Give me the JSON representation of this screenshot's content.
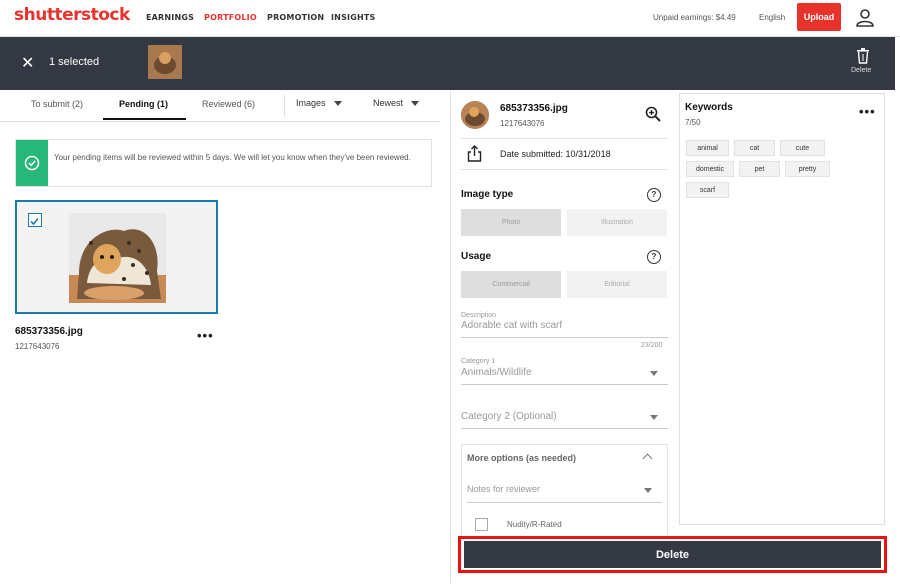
{
  "brand": {
    "logo_text": "shutterstock",
    "accent": "#e8332d"
  },
  "topnav": {
    "items": [
      {
        "label": "EARNINGS",
        "active": false
      },
      {
        "label": "PORTFOLIO",
        "active": true
      },
      {
        "label": "PROMOTION",
        "active": false
      },
      {
        "label": "INSIGHTS",
        "active": false
      }
    ],
    "earnings": "Unpaid earnings: $4.49",
    "language": "English",
    "upload_label": "Upload",
    "user_icon": "user-icon"
  },
  "selection_bar": {
    "close_icon": "close-icon",
    "selected_text": "1 selected",
    "delete_label": "Delete",
    "bg": "#333842"
  },
  "tabs": [
    {
      "label": "To submit (2)",
      "active": false
    },
    {
      "label": "Pending (1)",
      "active": true
    },
    {
      "label": "Reviewed (6)",
      "active": false
    }
  ],
  "filters": {
    "type": "Images",
    "sort": "Newest"
  },
  "notice": {
    "text": "Your pending items will be reviewed within 5 days. We will let you know when they've been reviewed.",
    "color": "#27b77a"
  },
  "item": {
    "filename": "685373356.jpg",
    "id": "1217643076",
    "checked": true
  },
  "details": {
    "filename": "685373356.jpg",
    "id": "1217643076",
    "date_submitted": "Date submitted: 10/31/2018",
    "image_type": {
      "label": "Image type",
      "options": [
        "Photo",
        "Illustration"
      ],
      "selected": "Photo"
    },
    "usage": {
      "label": "Usage",
      "options": [
        "Commercial",
        "Editorial"
      ],
      "selected": "Commercial"
    },
    "description": {
      "label": "Description",
      "value": "Adorable cat with scarf",
      "count": "23/200"
    },
    "category1": {
      "label": "Category 1",
      "value": "Animals/Wildlife"
    },
    "category2": {
      "placeholder": "Category 2 (Optional)"
    },
    "more_options": {
      "label": "More options (as needed)",
      "notes_placeholder": "Notes for reviewer",
      "nudity_label": "Nudity/R-Rated"
    },
    "delete_label": "Delete"
  },
  "keywords": {
    "title": "Keywords",
    "count": "7/50",
    "items": [
      "animal",
      "cat",
      "cute",
      "domestic",
      "pet",
      "pretty",
      "scarf"
    ]
  }
}
